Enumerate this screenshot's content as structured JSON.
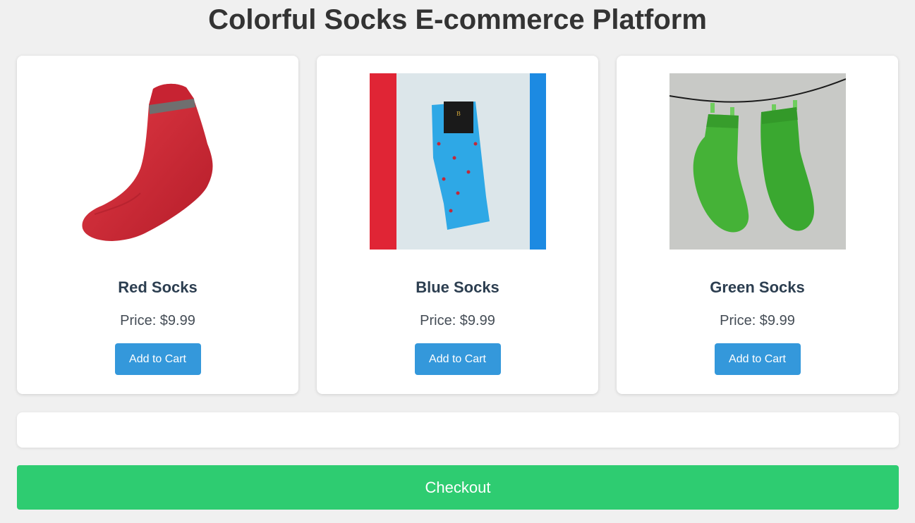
{
  "page": {
    "title": "Colorful Socks E-commerce Platform"
  },
  "products": [
    {
      "name": "Red Socks",
      "price": "Price: $9.99",
      "button_label": "Add to Cart",
      "image_icon": "red-sock-image",
      "color": "#d42b37"
    },
    {
      "name": "Blue Socks",
      "price": "Price: $9.99",
      "button_label": "Add to Cart",
      "image_icon": "blue-sock-image",
      "color": "#2ea8e6"
    },
    {
      "name": "Green Socks",
      "price": "Price: $9.99",
      "button_label": "Add to Cart",
      "image_icon": "green-socks-image",
      "color": "#3aa830"
    }
  ],
  "cart": {
    "summary": ""
  },
  "checkout": {
    "label": "Checkout"
  },
  "colors": {
    "background": "#f0f0f0",
    "card": "#ffffff",
    "add_button": "#3498db",
    "checkout_button": "#2ecc71",
    "title_text": "#333333",
    "name_text": "#2c3e50"
  }
}
